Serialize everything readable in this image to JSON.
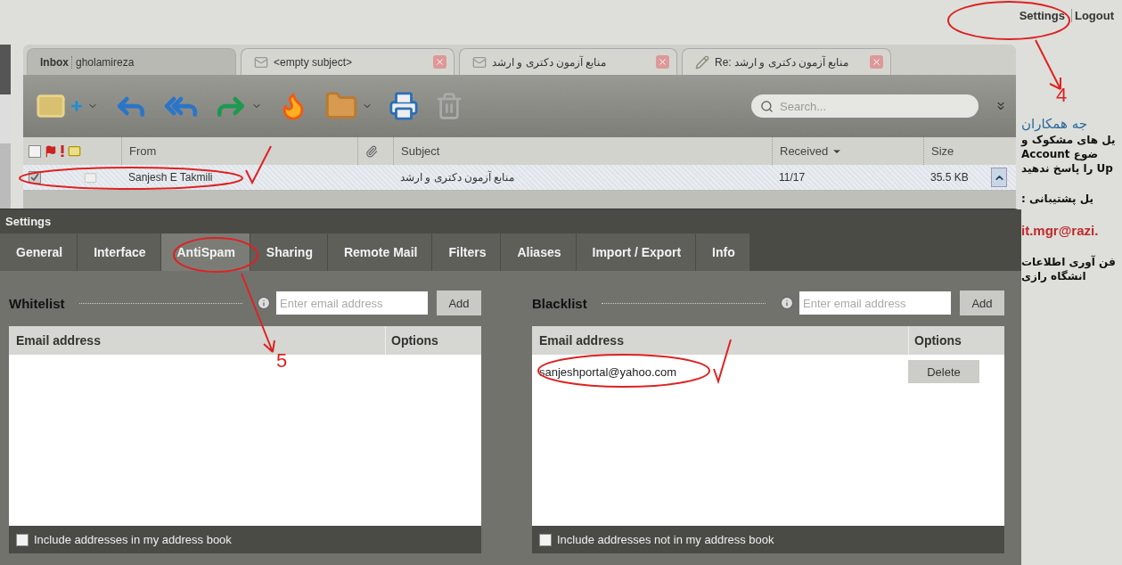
{
  "top_links": [
    {
      "label": "Settings"
    },
    {
      "label": "Logout"
    }
  ],
  "mail": {
    "tabs": [
      {
        "kind": "inbox",
        "label": "Inbox",
        "account": "gholamireza",
        "selected": true
      },
      {
        "kind": "message",
        "label": "<empty subject>",
        "selected": false
      },
      {
        "kind": "message",
        "label": "منابع آزمون دکتری و ارشد",
        "selected": false
      },
      {
        "kind": "reply",
        "label": "Re: منابع آزمون دکتری و ارشد",
        "selected": false
      }
    ],
    "search": {
      "placeholder": "Search..."
    },
    "header_checked": false,
    "columns": [
      {
        "label": "From",
        "sorted": false
      },
      {
        "label": "Subject",
        "sorted": false
      },
      {
        "label": "Received",
        "sorted": true
      },
      {
        "label": "Size",
        "sorted": false
      }
    ],
    "rows": [
      {
        "checked": true,
        "selected": true,
        "from": "Sanjesh E Takmili",
        "subject": "منابع آزمون دکتری و ارشد",
        "received": "11/17",
        "size": "35.5 KB"
      }
    ]
  },
  "settings": {
    "title": "Settings",
    "tabs": [
      {
        "label": "General",
        "selected": false
      },
      {
        "label": "Interface",
        "selected": false
      },
      {
        "label": "AntiSpam",
        "selected": true
      },
      {
        "label": "Sharing",
        "selected": false
      },
      {
        "label": "Remote Mail",
        "selected": false
      },
      {
        "label": "Filters",
        "selected": false
      },
      {
        "label": "Aliases",
        "selected": false
      },
      {
        "label": "Import / Export",
        "selected": false
      },
      {
        "label": "Info",
        "selected": false
      }
    ],
    "lists": [
      {
        "title": "Whitelist",
        "placeholder": "Enter email address",
        "add": "Add",
        "columns": [
          "Email address",
          "Options"
        ],
        "footer": {
          "label": "Include addresses in my address book",
          "checked": false
        }
      },
      {
        "title": "Blacklist",
        "placeholder": "Enter email address",
        "add": "Add",
        "columns": [
          "Email address",
          "Options"
        ],
        "entries": [
          {
            "address": "sanjeshportal@yahoo.com",
            "action": "Delete"
          }
        ],
        "footer": {
          "label": "Include addresses not in my address book",
          "checked": false
        }
      }
    ]
  },
  "side_notice": [
    {
      "kind": "heading",
      "text": "جه همکاران"
    },
    {
      "kind": "text",
      "text": "یل های مشکوک و"
    },
    {
      "kind": "text",
      "text": "ضوع Account"
    },
    {
      "kind": "text",
      "text": "Up را پاسخ ندهید"
    },
    {
      "kind": "gap-text",
      "text": "یل پشتیبانی :"
    },
    {
      "kind": "email",
      "text": "it.mgr@razi."
    },
    {
      "kind": "gap-text",
      "text": "فن آوری اطلاعات"
    },
    {
      "kind": "text",
      "text": "انشگاه رازی"
    }
  ],
  "annotations": [
    {
      "text": "4"
    },
    {
      "text": "5"
    }
  ]
}
